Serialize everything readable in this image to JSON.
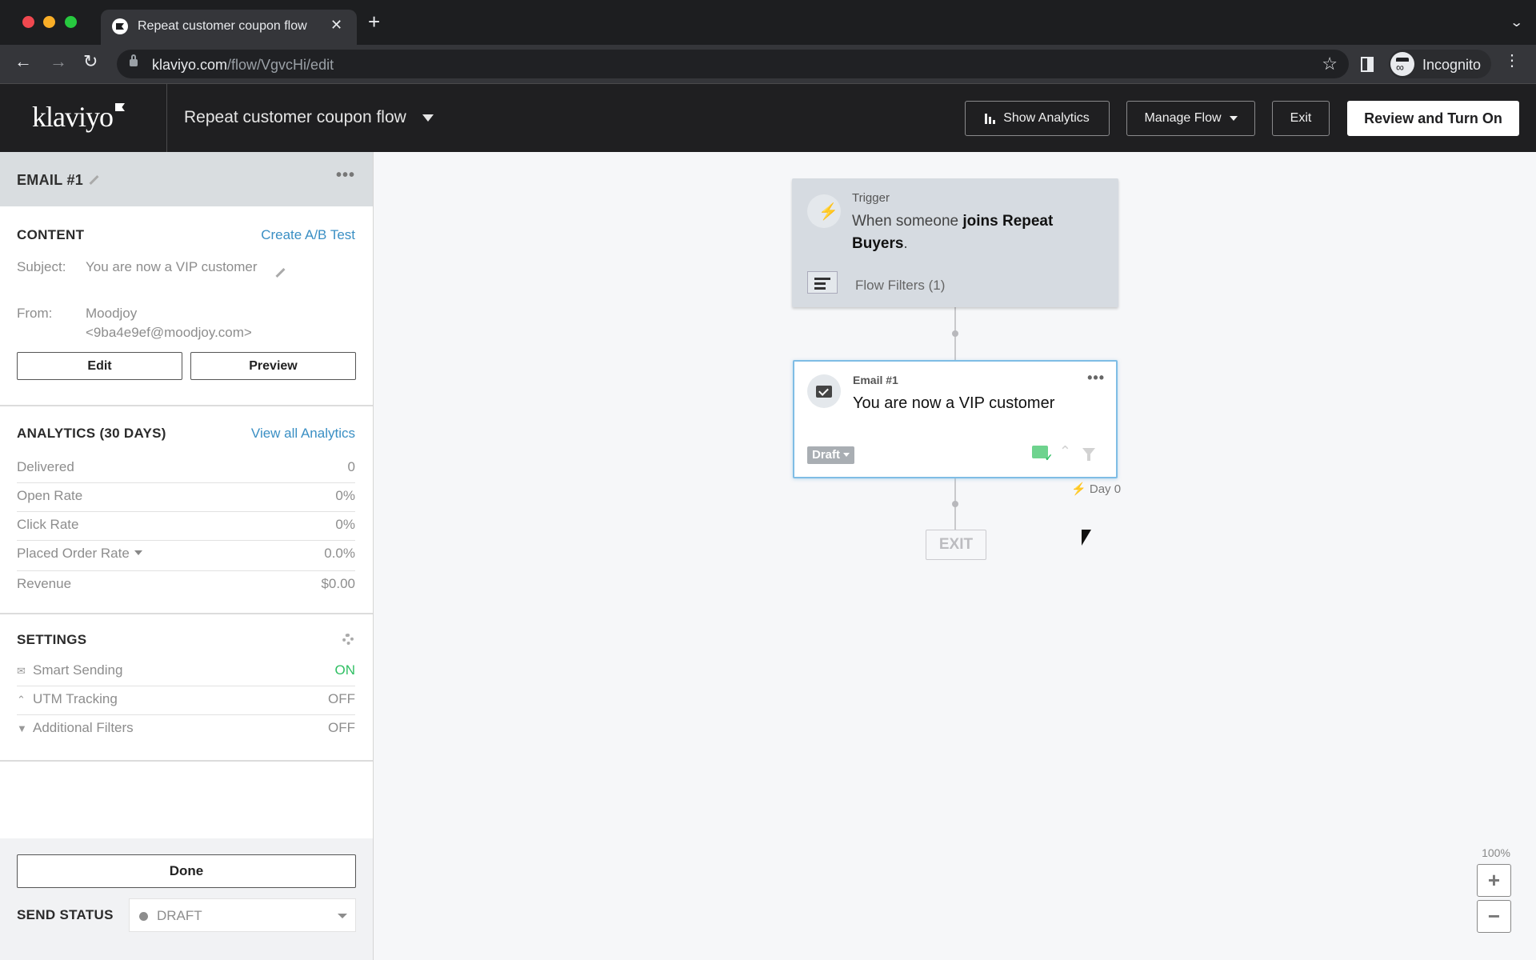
{
  "browser": {
    "tab_title": "Repeat customer coupon flow",
    "url_domain": "klaviyo.com",
    "url_path": "/flow/VgvcHi/edit",
    "profile_label": "Incognito"
  },
  "header": {
    "logo": "klaviyo",
    "flow_name": "Repeat customer coupon flow",
    "buttons": {
      "show_analytics": "Show Analytics",
      "manage_flow": "Manage Flow",
      "exit": "Exit",
      "review": "Review and Turn On"
    }
  },
  "panel": {
    "title": "EMAIL #1",
    "content": {
      "heading": "CONTENT",
      "ab_link": "Create A/B Test",
      "subject_label": "Subject:",
      "subject_value": "You are now a VIP customer",
      "from_label": "From:",
      "from_value": "Moodjoy <9ba4e9ef@moodjoy.com>",
      "edit_button": "Edit",
      "preview_button": "Preview"
    },
    "analytics": {
      "heading": "ANALYTICS (30 DAYS)",
      "link": "View all Analytics",
      "rows": [
        {
          "label": "Delivered",
          "value": "0"
        },
        {
          "label": "Open Rate",
          "value": "0%"
        },
        {
          "label": "Click Rate",
          "value": "0%"
        },
        {
          "label": "Placed Order Rate",
          "value": "0.0%"
        },
        {
          "label": "Revenue",
          "value": "$0.00"
        }
      ]
    },
    "settings": {
      "heading": "SETTINGS",
      "rows": [
        {
          "label": "Smart Sending",
          "value": "ON"
        },
        {
          "label": "UTM Tracking",
          "value": "OFF"
        },
        {
          "label": "Additional Filters",
          "value": "OFF"
        }
      ]
    },
    "done_button": "Done",
    "send_status_label": "SEND STATUS",
    "send_status_value": "DRAFT"
  },
  "canvas": {
    "trigger": {
      "kicker": "Trigger",
      "text_prefix": "When someone ",
      "text_bold": "joins Repeat Buyers",
      "text_suffix": ".",
      "filters": "Flow Filters (1)"
    },
    "email": {
      "kicker": "Email #1",
      "subject": "You are now a VIP customer",
      "status": "Draft",
      "delay": "Day 0"
    },
    "exit_label": "EXIT",
    "zoom_level": "100%"
  },
  "colors": {
    "link": "#3a8fc4",
    "on_green": "#2fbf63",
    "selected_border": "#7fbde5"
  }
}
